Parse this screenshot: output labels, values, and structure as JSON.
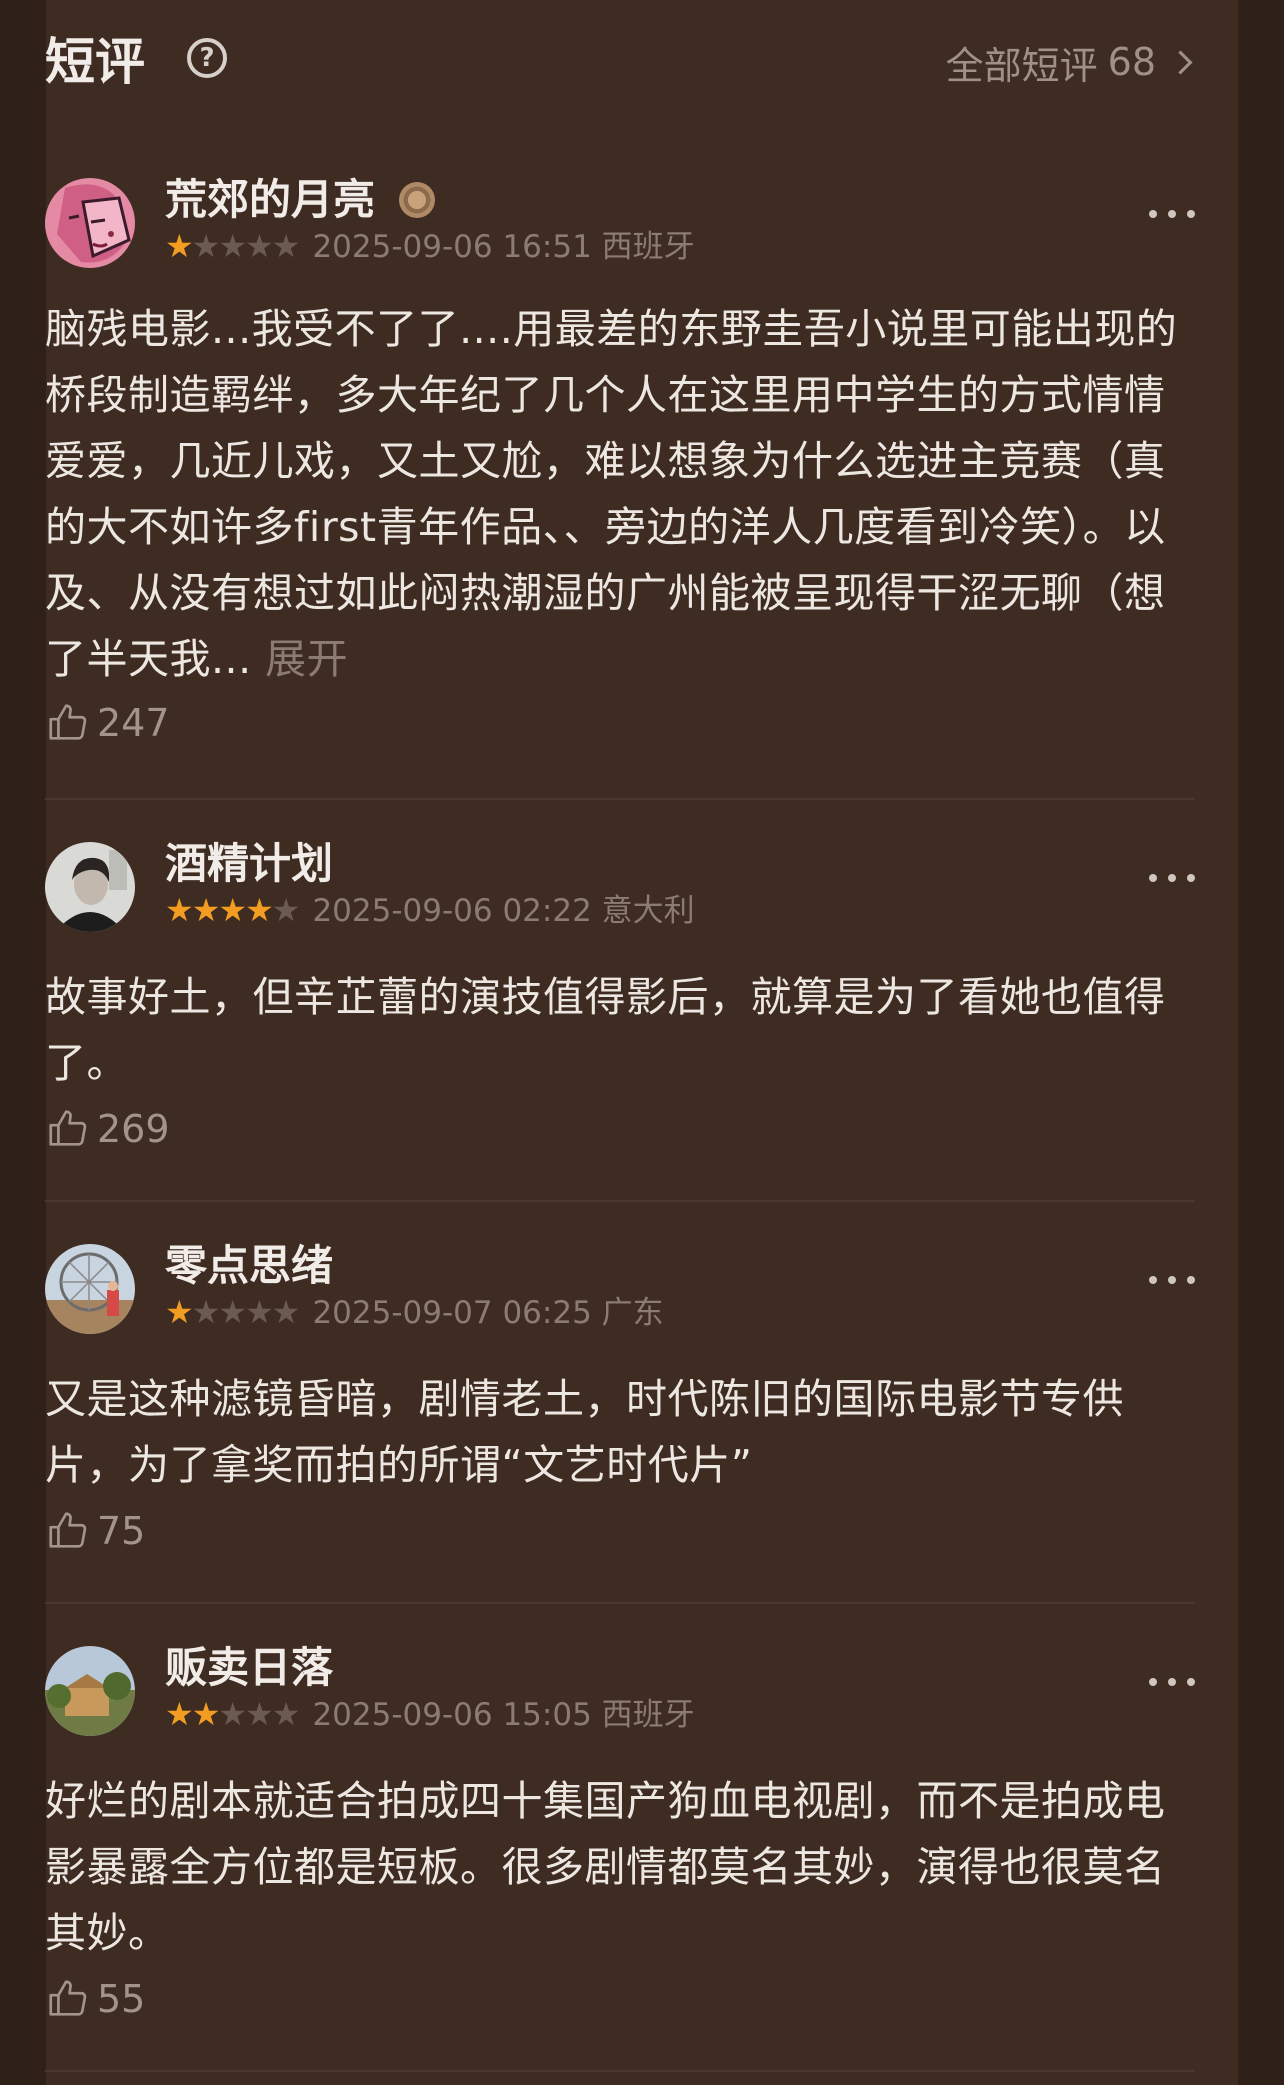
{
  "header": {
    "title": "短评",
    "help_icon": "question-circle-icon",
    "all_reviews_label": "全部短评",
    "all_reviews_count": "68"
  },
  "colors": {
    "background": "#2f2119",
    "card": "#3e2b22",
    "star_active": "#f29d21",
    "star_inactive": "#6b5a51"
  },
  "reviews": [
    {
      "username": "荒郊的月亮",
      "rating": 1,
      "datetime": "2025-09-06 16:51",
      "location": "西班牙",
      "text": "脑残电影...我受不了了....用最差的东野圭吾小说里可能出现的桥段制造羁绊，多大年纪了几个人在这里用中学生的方式情情爱爱，几近儿戏，又土又尬，难以想象为什么选进主竞赛（真的大不如许多first青年作品、、旁边的洋人几度看到冷笑）。以及、从没有想过如此闷热潮湿的广州能被呈现得干涩无聊（想了半天我...",
      "expand_label": "展开",
      "likes": "247"
    },
    {
      "username": "酒精计划",
      "rating": 4,
      "datetime": "2025-09-06 02:22",
      "location": "意大利",
      "text": "故事好土，但辛芷蕾的演技值得影后，就算是为了看她也值得了。",
      "likes": "269"
    },
    {
      "username": "零点思绪",
      "rating": 1,
      "datetime": "2025-09-07 06:25",
      "location": "广东",
      "text": "又是这种滤镜昏暗，剧情老土，时代陈旧的国际电影节专供片，为了拿奖而拍的所谓“文艺时代片”",
      "likes": "75"
    },
    {
      "username": "贩卖日落",
      "rating": 2,
      "datetime": "2025-09-06 15:05",
      "location": "西班牙",
      "text": "好烂的剧本就适合拍成四十集国产狗血电视剧，而不是拍成电影暴露全方位都是短板。很多剧情都莫名其妙，演得也很莫名其妙。",
      "likes": "55"
    }
  ]
}
